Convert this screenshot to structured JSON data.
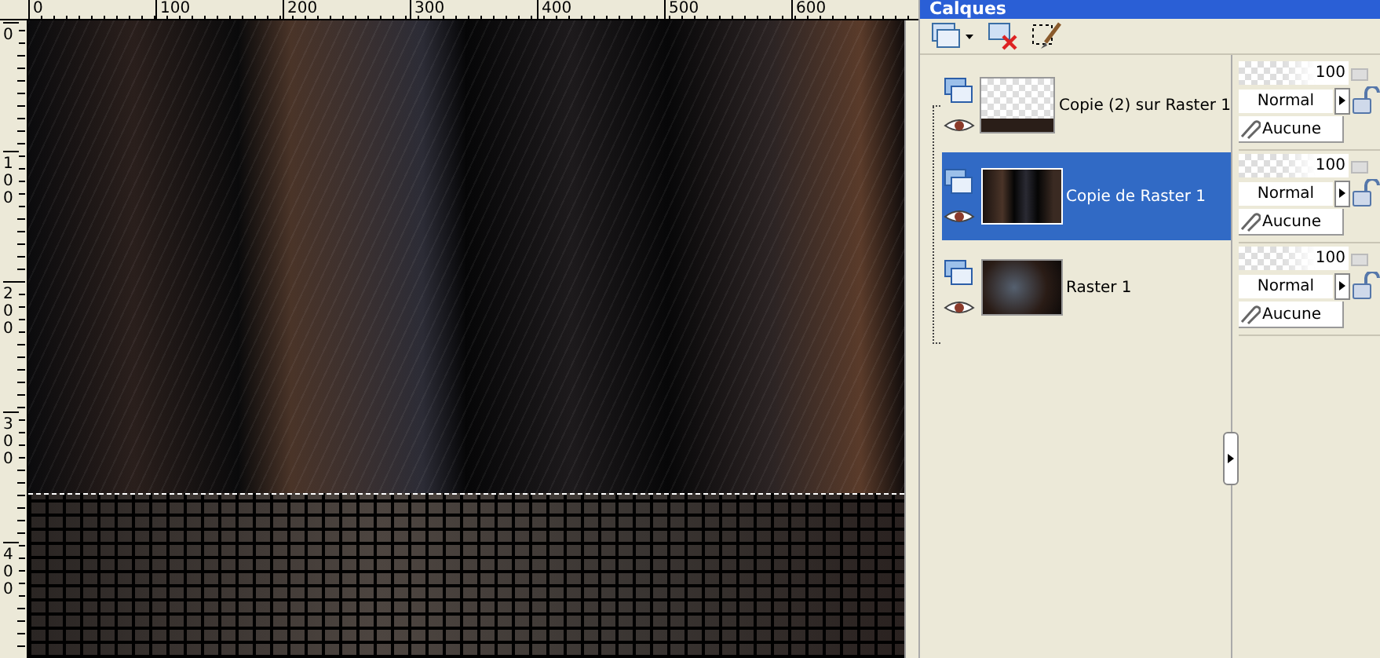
{
  "palette": {
    "title": "Calques"
  },
  "rulers": {
    "horizontal": [
      "0",
      "100",
      "200",
      "300",
      "400",
      "500",
      "600"
    ],
    "vertical": [
      "0",
      "100",
      "200",
      "300",
      "400"
    ]
  },
  "layers": [
    {
      "name": "Copie (2) sur Raster 1",
      "selected": false,
      "kind": "floor",
      "opacity": "100",
      "blend": "Normal",
      "mask": "Aucune"
    },
    {
      "name": "Copie de Raster 1",
      "selected": true,
      "kind": "stripes",
      "opacity": "100",
      "blend": "Normal",
      "mask": "Aucune"
    },
    {
      "name": "Raster 1",
      "selected": false,
      "kind": "blur",
      "opacity": "100",
      "blend": "Normal",
      "mask": "Aucune"
    }
  ]
}
